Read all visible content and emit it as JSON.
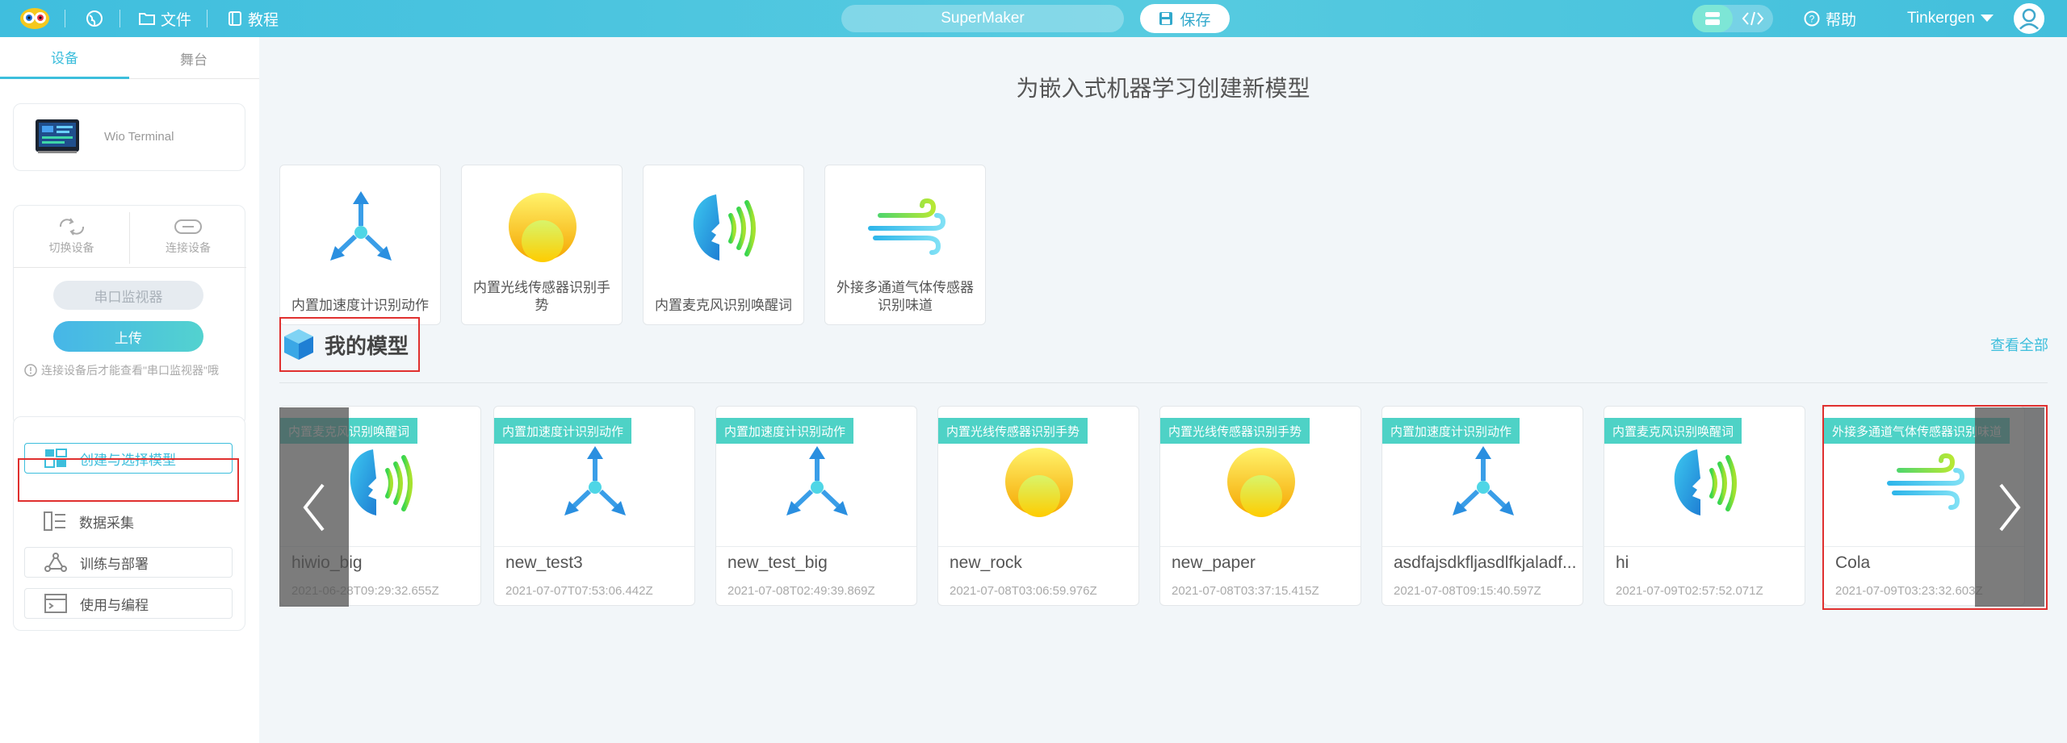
{
  "topbar": {
    "file_label": "文件",
    "tutorial_label": "教程",
    "project_name": "SuperMaker",
    "save_label": "保存",
    "help_label": "帮助",
    "username": "Tinkergen"
  },
  "sidebar": {
    "tabs": [
      "设备",
      "舞台"
    ],
    "device_name": "Wio Terminal",
    "switch_device": "切换设备",
    "connect_device": "连接设备",
    "serial_monitor": "串口监视器",
    "upload": "上传",
    "hint": "连接设备后才能查看\"串口监视器\"哦",
    "nav": [
      "创建与选择模型",
      "数据采集",
      "训练与部署",
      "使用与编程"
    ]
  },
  "main": {
    "title": "为嵌入式机器学习创建新模型",
    "templates": [
      {
        "label": "内置加速度计识别动作",
        "icon": "accelerometer-icon"
      },
      {
        "label": "内置光线传感器识别手势",
        "icon": "light-sensor-icon"
      },
      {
        "label": "内置麦克风识别唤醒词",
        "icon": "microphone-icon"
      },
      {
        "label": "外接多通道气体传感器识别味道",
        "icon": "gas-sensor-icon"
      }
    ],
    "my_models_title": "我的模型",
    "view_all": "查看全部",
    "models": [
      {
        "tag": "内置麦克风识别唤醒词",
        "name": "hiwio_big",
        "time": "2021-06-28T09:29:32.655Z",
        "icon": "microphone-icon"
      },
      {
        "tag": "内置加速度计识别动作",
        "name": "new_test3",
        "time": "2021-07-07T07:53:06.442Z",
        "icon": "accelerometer-icon"
      },
      {
        "tag": "内置加速度计识别动作",
        "name": "new_test_big",
        "time": "2021-07-08T02:49:39.869Z",
        "icon": "accelerometer-icon"
      },
      {
        "tag": "内置光线传感器识别手势",
        "name": "new_rock",
        "time": "2021-07-08T03:06:59.976Z",
        "icon": "light-sensor-icon"
      },
      {
        "tag": "内置光线传感器识别手势",
        "name": "new_paper",
        "time": "2021-07-08T03:37:15.415Z",
        "icon": "light-sensor-icon"
      },
      {
        "tag": "内置加速度计识别动作",
        "name": "asdfajsdkfljasdlfkjaladf...",
        "time": "2021-07-08T09:15:40.597Z",
        "icon": "accelerometer-icon"
      },
      {
        "tag": "内置麦克风识别唤醒词",
        "name": "hi",
        "time": "2021-07-09T02:57:52.071Z",
        "icon": "microphone-icon"
      },
      {
        "tag": "外接多通道气体传感器识别味道",
        "name": "Cola",
        "time": "2021-07-09T03:23:32.603Z",
        "icon": "gas-sensor-icon"
      }
    ]
  }
}
